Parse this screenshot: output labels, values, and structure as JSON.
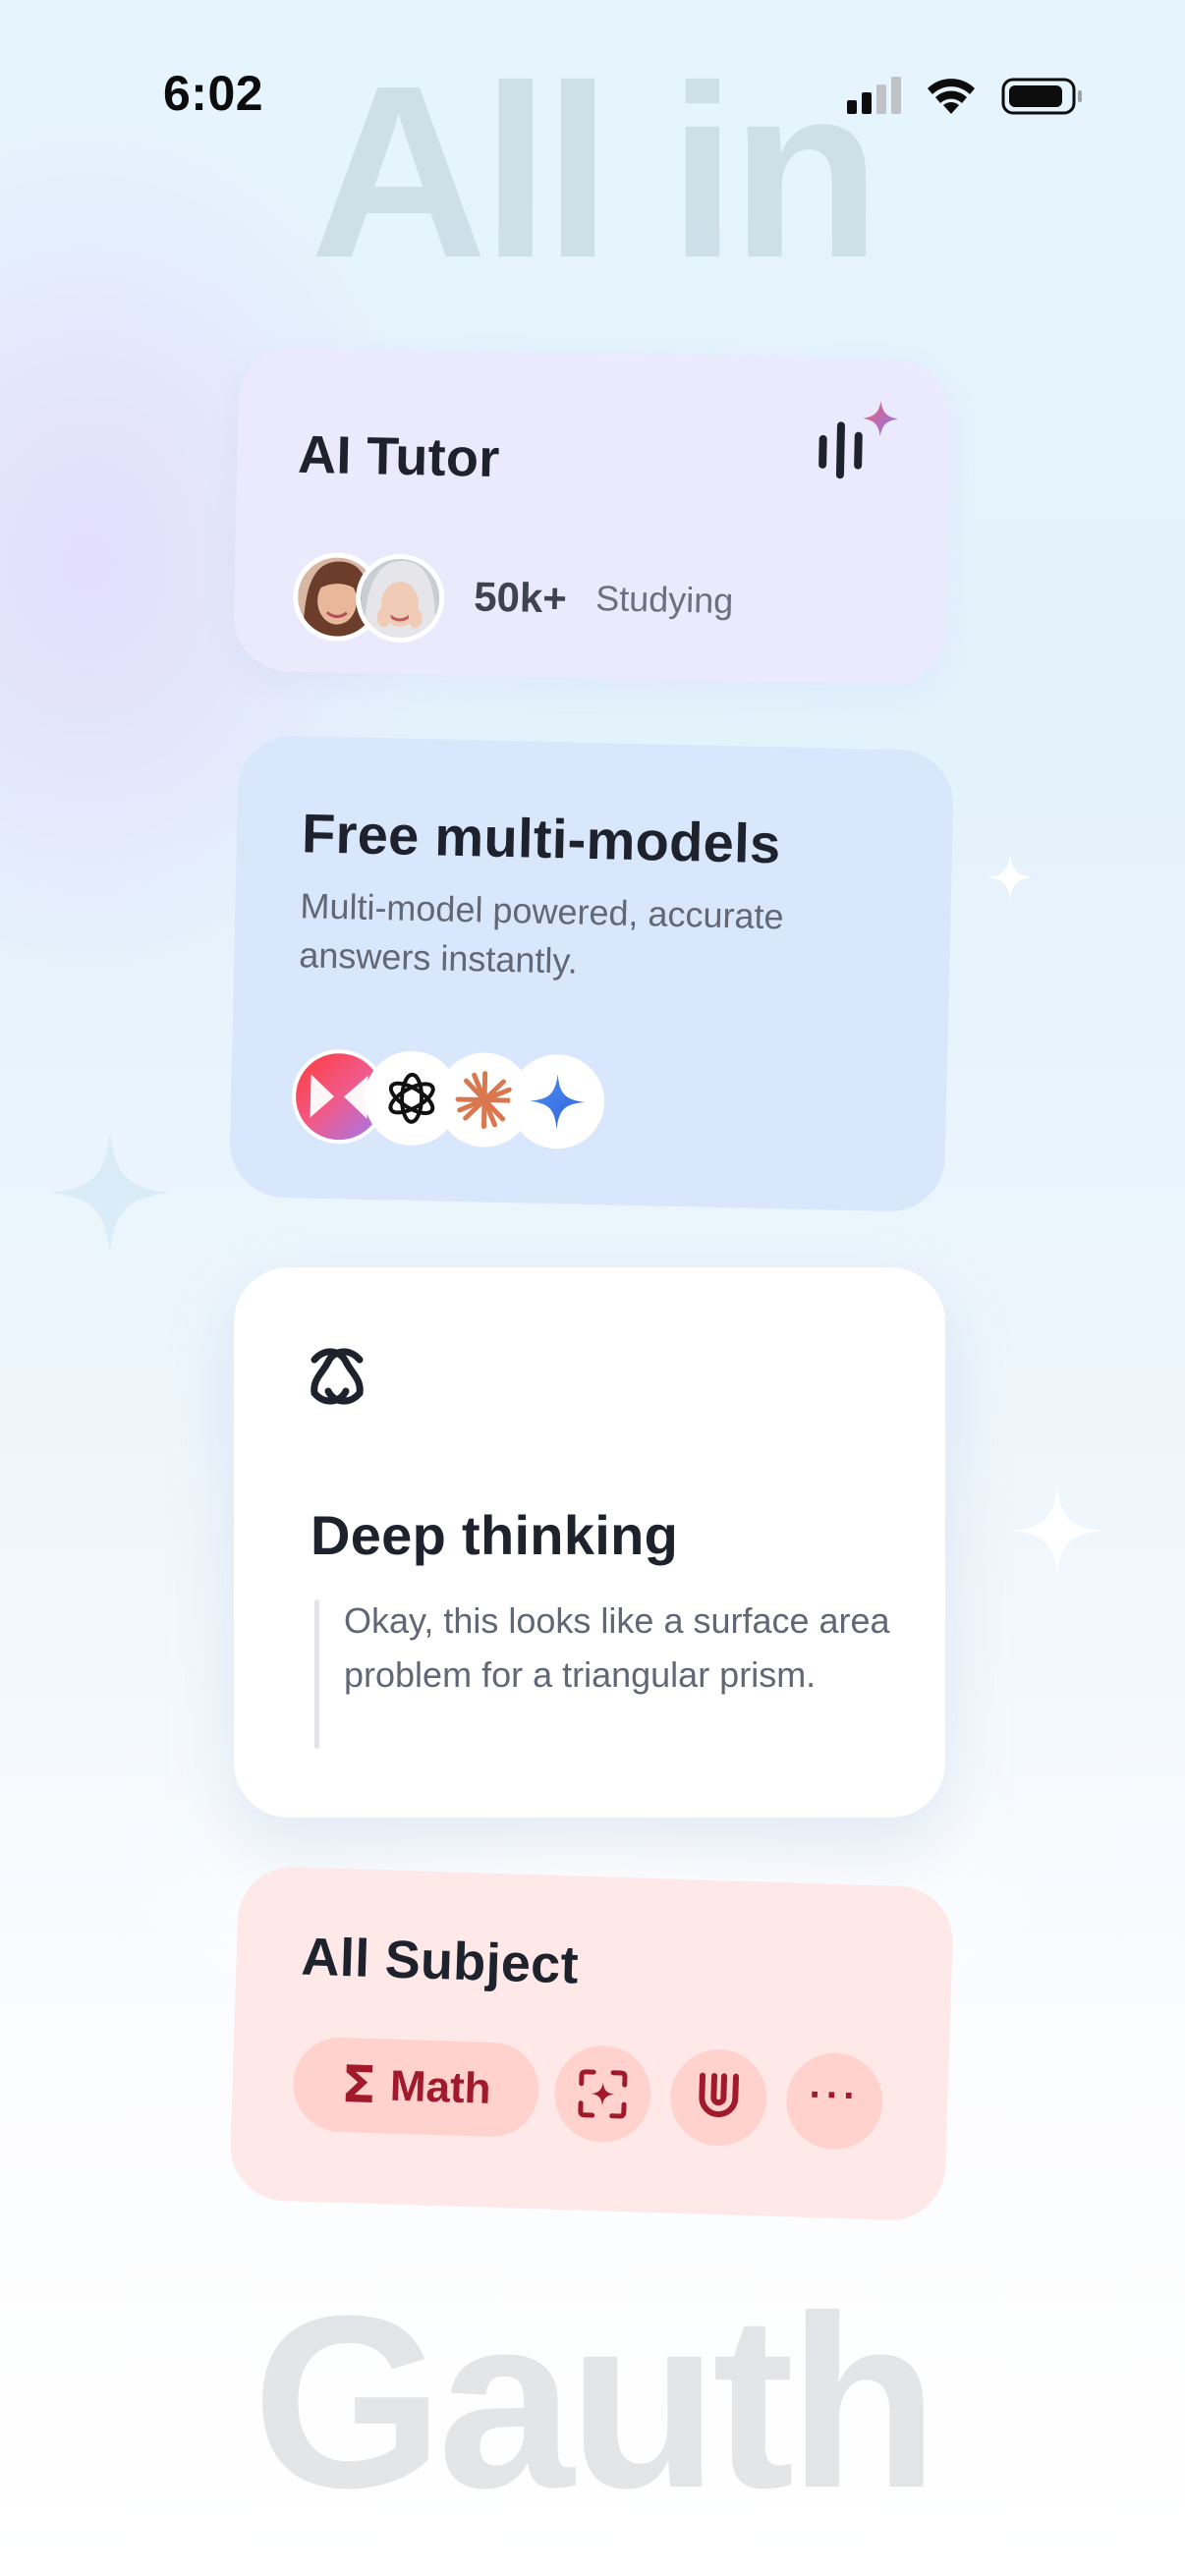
{
  "status_bar": {
    "time": "6:02",
    "icons": [
      "cellular-signal-icon",
      "wifi-icon",
      "battery-icon"
    ]
  },
  "background": {
    "top_text": "All in",
    "bottom_text": "Gauth"
  },
  "cards": {
    "ai_tutor": {
      "title": "AI Tutor",
      "count": "50k+",
      "count_label": "Studying",
      "icon": "voice-wave-sparkle-icon"
    },
    "multi_models": {
      "title": "Free multi-models",
      "description": "Multi-model powered, accurate answers instantly.",
      "logos": [
        "doubao-logo-icon",
        "openai-logo-icon",
        "claude-logo-icon",
        "gemini-logo-icon"
      ]
    },
    "deep_thinking": {
      "title": "Deep thinking",
      "quote": "Okay, this looks like a surface area problem for a triangular prism.",
      "icon": "atom-knot-icon"
    },
    "all_subject": {
      "title": "All Subject",
      "chip_math_symbol": "Σ",
      "chip_math_label": "Math",
      "chip_icons": [
        "scan-sparkle-icon",
        "magnet-icon",
        "more-icon"
      ],
      "more_label": "···"
    }
  },
  "colors": {
    "tutor_card": "#ebeafc",
    "models_card": "#d9e7fd",
    "deep_card": "#ffffff",
    "subject_card": "#fee9e8",
    "subject_accent": "#a11a2c"
  }
}
